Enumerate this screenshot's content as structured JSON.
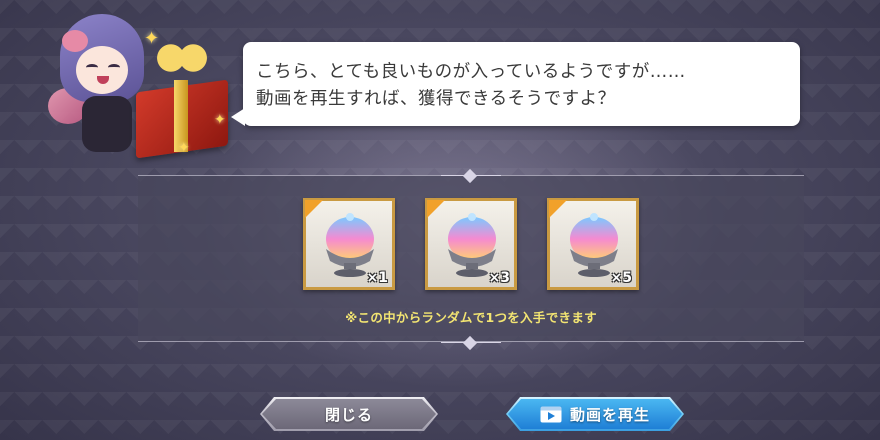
{
  "dialog": {
    "line1": "こちら、とても良いものが入っているようですが……",
    "line2": "動画を再生すれば、獲得できるそうですよ？"
  },
  "rewards": {
    "items": [
      {
        "icon": "crystal-dome-icon",
        "qty": "×1"
      },
      {
        "icon": "crystal-dome-icon",
        "qty": "×3"
      },
      {
        "icon": "crystal-dome-icon",
        "qty": "×5"
      }
    ],
    "note": "※この中からランダムで1つを入手できます"
  },
  "buttons": {
    "close_label": "閉じる",
    "play_label": "動画を再生",
    "play_icon": "video-play-icon"
  },
  "colors": {
    "play_button": "#1f7fd6",
    "note_text": "#f3e572",
    "item_frame": "#c99a42"
  }
}
